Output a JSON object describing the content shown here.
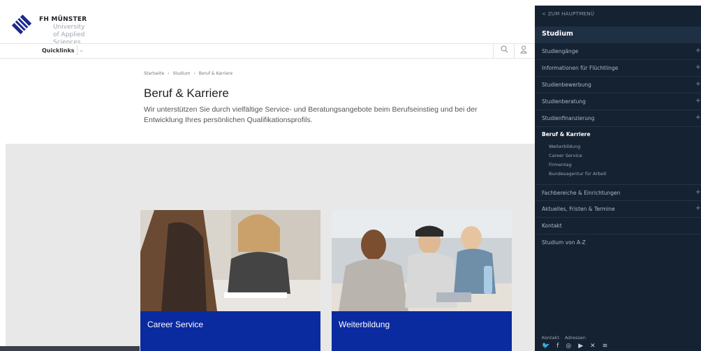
{
  "brand": {
    "name": "FH MÜNSTER",
    "subtitle": "University of Applied Sciences"
  },
  "quickbar": {
    "label": "Quicklinks",
    "chevron": "⌄"
  },
  "icons": {
    "search": "search-icon",
    "user": "user-icon"
  },
  "breadcrumb": [
    "Startseite",
    "Studium",
    "Beruf & Karriere"
  ],
  "breadcrumb_sep": "›",
  "page": {
    "title": "Beruf & Karriere",
    "lead": "Wir unterstützen Sie durch vielfältige Service- und Beratungsangebote beim Berufseinstieg und bei der Entwicklung Ihres persönlichen Qualifikationsprofils."
  },
  "cards": [
    {
      "title": "Career Service"
    },
    {
      "title": "Weiterbildung"
    }
  ],
  "menu": {
    "back": "< ZUM HAUPTMENÜ",
    "heading": "Studium",
    "items_top": [
      {
        "label": "Studiengänge",
        "expand": "+"
      },
      {
        "label": "Informationen für Flüchtlinge",
        "expand": "+"
      },
      {
        "label": "Studienbewerbung",
        "expand": "+"
      },
      {
        "label": "Studienberatung",
        "expand": "+"
      },
      {
        "label": "Studienfinanzierung",
        "expand": "+"
      }
    ],
    "active": "Beruf & Karriere",
    "subitems": [
      "Weiterbildung",
      "Career Service",
      "Firmentag",
      "Bundesagentur für Arbeit"
    ],
    "items_bottom": [
      {
        "label": "Fachbereiche & Einrichtungen",
        "expand": "+"
      },
      {
        "label": "Aktuelles, Fristen & Termine",
        "expand": "+"
      },
      {
        "label": "Kontakt",
        "expand": ""
      },
      {
        "label": "Studium von A-Z",
        "expand": ""
      }
    ],
    "footer_links": [
      "Kontakt",
      "Adressen"
    ],
    "social": [
      "twitter-icon",
      "facebook-icon",
      "instagram-icon",
      "youtube-icon",
      "xing-icon",
      "rss-icon"
    ]
  },
  "colors": {
    "menu_bg": "#152232",
    "card_blue": "#0a2aa0",
    "band_grey": "#e8e8e8"
  }
}
